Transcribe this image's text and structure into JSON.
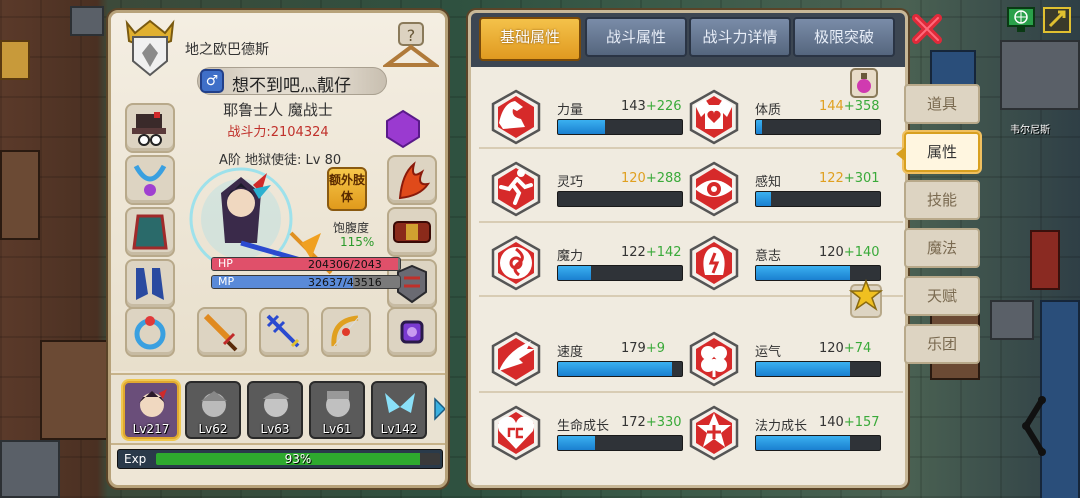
{
  "player": {
    "guild": "地之欧巴德斯",
    "gender_symbol": "♂",
    "name": "想不到吧灬靓仔",
    "class": "耶鲁士人 魔战士",
    "power": "战斗力:2104324",
    "rank": "A阶 地狱使徒: Lv 80",
    "extra_limb": "额外肢体",
    "satiety_label": "饱腹度",
    "satiety_value": "115%",
    "hp_label": "HP",
    "hp_value": "204306/2043",
    "hp_fraction": 0.99,
    "mp_label": "MP",
    "mp_value": "32637/43516",
    "mp_fraction": 0.75
  },
  "team": [
    {
      "level": "Lv217",
      "active": true
    },
    {
      "level": "Lv62",
      "active": false
    },
    {
      "level": "Lv63",
      "active": false
    },
    {
      "level": "Lv61",
      "active": false
    },
    {
      "level": "Lv142",
      "active": false
    }
  ],
  "exp": {
    "label": "Exp",
    "percent": "93%",
    "fraction": 0.93
  },
  "tabs": [
    "基础属性",
    "战斗属性",
    "战斗力详情",
    "极限突破"
  ],
  "stats": [
    {
      "name": "力量",
      "base": "143",
      "bonus": "+226",
      "fill": 0.38,
      "gold": false,
      "icon": "strength-icon"
    },
    {
      "name": "体质",
      "base": "144",
      "bonus": "+358",
      "fill": 0.05,
      "gold": true,
      "icon": "constitution-icon"
    },
    {
      "name": "灵巧",
      "base": "120",
      "bonus": "+288",
      "fill": 0.0,
      "gold": true,
      "icon": "agility-icon"
    },
    {
      "name": "感知",
      "base": "122",
      "bonus": "+301",
      "fill": 0.12,
      "gold": true,
      "icon": "perception-icon"
    },
    {
      "name": "魔力",
      "base": "122",
      "bonus": "+142",
      "fill": 0.27,
      "gold": false,
      "icon": "magic-icon"
    },
    {
      "name": "意志",
      "base": "120",
      "bonus": "+140",
      "fill": 0.76,
      "gold": false,
      "icon": "will-icon"
    },
    {
      "name": "速度",
      "base": "179",
      "bonus": "+9",
      "fill": 0.92,
      "gold": false,
      "icon": "speed-icon"
    },
    {
      "name": "运气",
      "base": "120",
      "bonus": "+74",
      "fill": 0.76,
      "gold": false,
      "icon": "luck-icon"
    },
    {
      "name": "生命成长",
      "base": "172",
      "bonus": "+330",
      "fill": 0.3,
      "gold": false,
      "icon": "life-growth-icon"
    },
    {
      "name": "法力成长",
      "base": "140",
      "bonus": "+157",
      "fill": 0.76,
      "gold": false,
      "icon": "mana-growth-icon"
    }
  ],
  "side_menu": [
    "道具",
    "属性",
    "技能",
    "魔法",
    "天赋",
    "乐团"
  ],
  "map_label": "韦尔尼斯",
  "colors": {
    "accent": "#e09a20",
    "stat_bar": "#1a80d0",
    "bonus": "#3aaa3a",
    "power": "#c0302a",
    "stat_icon": "#d62a2a"
  }
}
